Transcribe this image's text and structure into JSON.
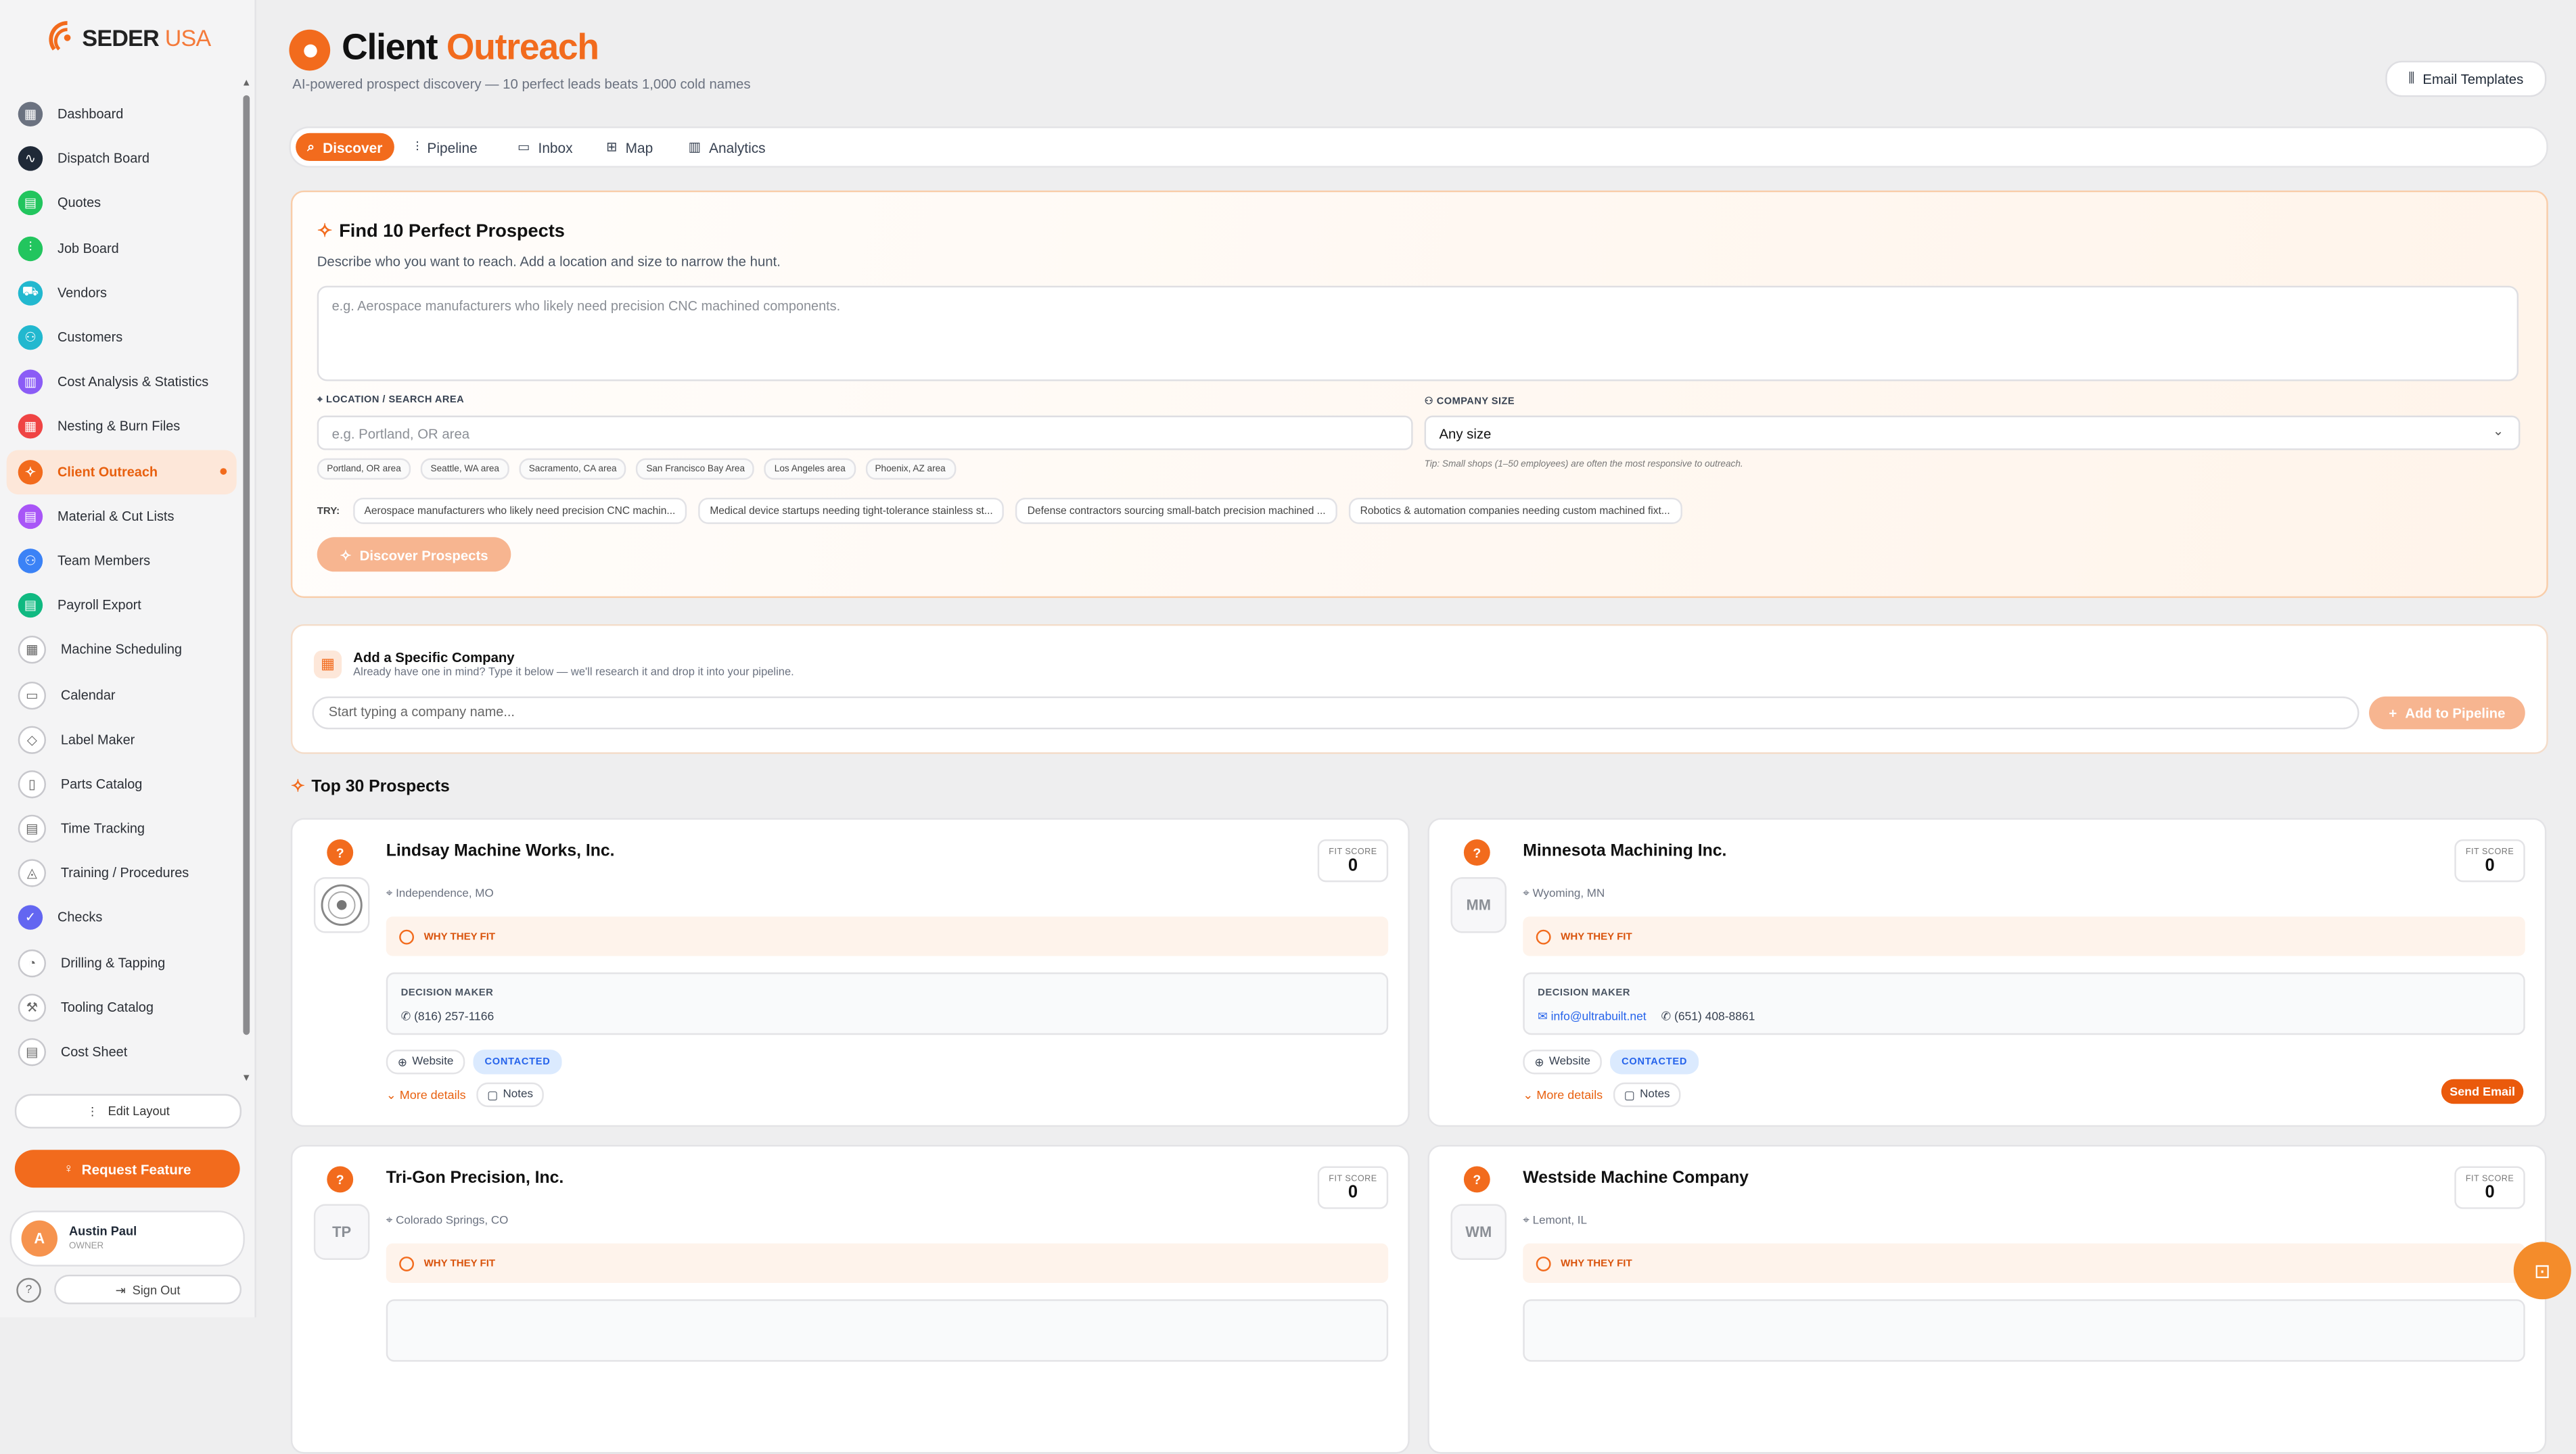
{
  "brand": {
    "name_main": "SEDER",
    "name_accent": "USA",
    "accent_color": "#f26b1d"
  },
  "sidebar": {
    "items": [
      {
        "label": "Dashboard",
        "icon": "grid-icon",
        "color": "#6b7280"
      },
      {
        "label": "Dispatch Board",
        "icon": "activity-icon",
        "color": "#1f2937"
      },
      {
        "label": "Quotes",
        "icon": "document-icon",
        "color": "#22c55e"
      },
      {
        "label": "Job Board",
        "icon": "kanban-icon",
        "color": "#22c55e"
      },
      {
        "label": "Vendors",
        "icon": "truck-icon",
        "color": "#22b8cf"
      },
      {
        "label": "Customers",
        "icon": "users-icon",
        "color": "#22b8cf"
      },
      {
        "label": "Cost Analysis & Statistics",
        "icon": "bar-chart-icon",
        "color": "#8b5cf6"
      },
      {
        "label": "Nesting & Burn Files",
        "icon": "grid-icon",
        "color": "#ef4444"
      },
      {
        "label": "Client Outreach",
        "icon": "sparkle-icon",
        "color": "#f26b1d",
        "active": true
      },
      {
        "label": "Material & Cut Lists",
        "icon": "document-icon",
        "color": "#a855f7"
      },
      {
        "label": "Team Members",
        "icon": "users-icon",
        "color": "#3b82f6"
      },
      {
        "label": "Payroll Export",
        "icon": "document-icon",
        "color": "#10b981"
      },
      {
        "label": "Machine Scheduling",
        "icon": "grid-icon",
        "color": "#d1d5db"
      },
      {
        "label": "Calendar",
        "icon": "calendar-icon",
        "color": "#d1d5db"
      },
      {
        "label": "Label Maker",
        "icon": "tag-icon",
        "color": "#d1d5db"
      },
      {
        "label": "Parts Catalog",
        "icon": "book-icon",
        "color": "#d1d5db"
      },
      {
        "label": "Time Tracking",
        "icon": "document-icon",
        "color": "#d1d5db"
      },
      {
        "label": "Training / Procedures",
        "icon": "graduation-cap-icon",
        "color": "#d1d5db"
      },
      {
        "label": "Checks",
        "icon": "check-icon",
        "color": "#6366f1"
      },
      {
        "label": "Drilling & Tapping",
        "icon": "gauge-icon",
        "color": "#d1d5db"
      },
      {
        "label": "Tooling Catalog",
        "icon": "wrench-icon",
        "color": "#d1d5db"
      },
      {
        "label": "Cost Sheet",
        "icon": "document-icon",
        "color": "#d1d5db"
      }
    ],
    "edit_layout": "Edit Layout",
    "request_feature": "Request Feature",
    "user": {
      "initial": "A",
      "name": "Austin Paul",
      "role": "OWNER"
    },
    "sign_out": "Sign Out"
  },
  "header": {
    "title_main": "Client ",
    "title_accent": "Outreach",
    "subtitle": "AI-powered prospect discovery — 10 perfect leads beats 1,000 cold names",
    "email_templates": "Email Templates"
  },
  "tabs": [
    {
      "label": "Discover",
      "icon": "search-icon",
      "active": true
    },
    {
      "label": "Pipeline",
      "icon": "kanban-icon"
    },
    {
      "label": "Inbox",
      "icon": "inbox-icon"
    },
    {
      "label": "Map",
      "icon": "map-icon"
    },
    {
      "label": "Analytics",
      "icon": "bar-chart-icon"
    }
  ],
  "find": {
    "title": "Find 10 Perfect Prospects",
    "description": "Describe who you want to reach. Add a location and size to narrow the hunt.",
    "textarea_placeholder": "e.g. Aerospace manufacturers who likely need precision CNC machined components.",
    "location_label": "LOCATION / SEARCH AREA",
    "location_placeholder": "e.g. Portland, OR area",
    "location_chips": [
      "Portland, OR area",
      "Seattle, WA area",
      "Sacramento, CA area",
      "San Francisco Bay Area",
      "Los Angeles area",
      "Phoenix, AZ area"
    ],
    "size_label": "COMPANY SIZE",
    "size_value": "Any size",
    "size_tip": "Tip: Small shops (1–50 employees) are often the most responsive to outreach.",
    "try_label": "TRY:",
    "try_chips": [
      "Aerospace manufacturers who likely need precision CNC machin...",
      "Medical device startups needing tight-tolerance stainless st...",
      "Defense contractors sourcing small-batch precision machined ...",
      "Robotics & automation companies needing custom machined fixt..."
    ],
    "discover_button": "Discover Prospects"
  },
  "add_company": {
    "title": "Add a Specific Company",
    "subtitle": "Already have one in mind? Type it below — we'll research it and drop it into your pipeline.",
    "input_placeholder": "Start typing a company name...",
    "add_button": "Add to Pipeline"
  },
  "prospects": {
    "heading": "Top 30 Prospects",
    "fit_label": "FIT SCORE",
    "why_label": "WHY THEY FIT",
    "dm_label": "DECISION MAKER",
    "more_details": "More details",
    "notes": "Notes",
    "website": "Website",
    "send_email": "Send Email",
    "cards": [
      {
        "name": "Lindsay Machine Works, Inc.",
        "location": "Independence, MO",
        "fit": "0",
        "initials": "",
        "phone": "(816) 257-1166",
        "email": "",
        "status": "CONTACTED",
        "has_logo": true
      },
      {
        "name": "Minnesota Machining Inc.",
        "location": "Wyoming, MN",
        "fit": "0",
        "initials": "MM",
        "phone": "(651) 408-8861",
        "email": "info@ultrabuilt.net",
        "status": "CONTACTED",
        "send": true
      },
      {
        "name": "Tri-Gon Precision, Inc.",
        "location": "Colorado Springs, CO",
        "fit": "0",
        "initials": "TP"
      },
      {
        "name": "Westside Machine Company",
        "location": "Lemont, IL",
        "fit": "0",
        "initials": "WM"
      }
    ]
  }
}
